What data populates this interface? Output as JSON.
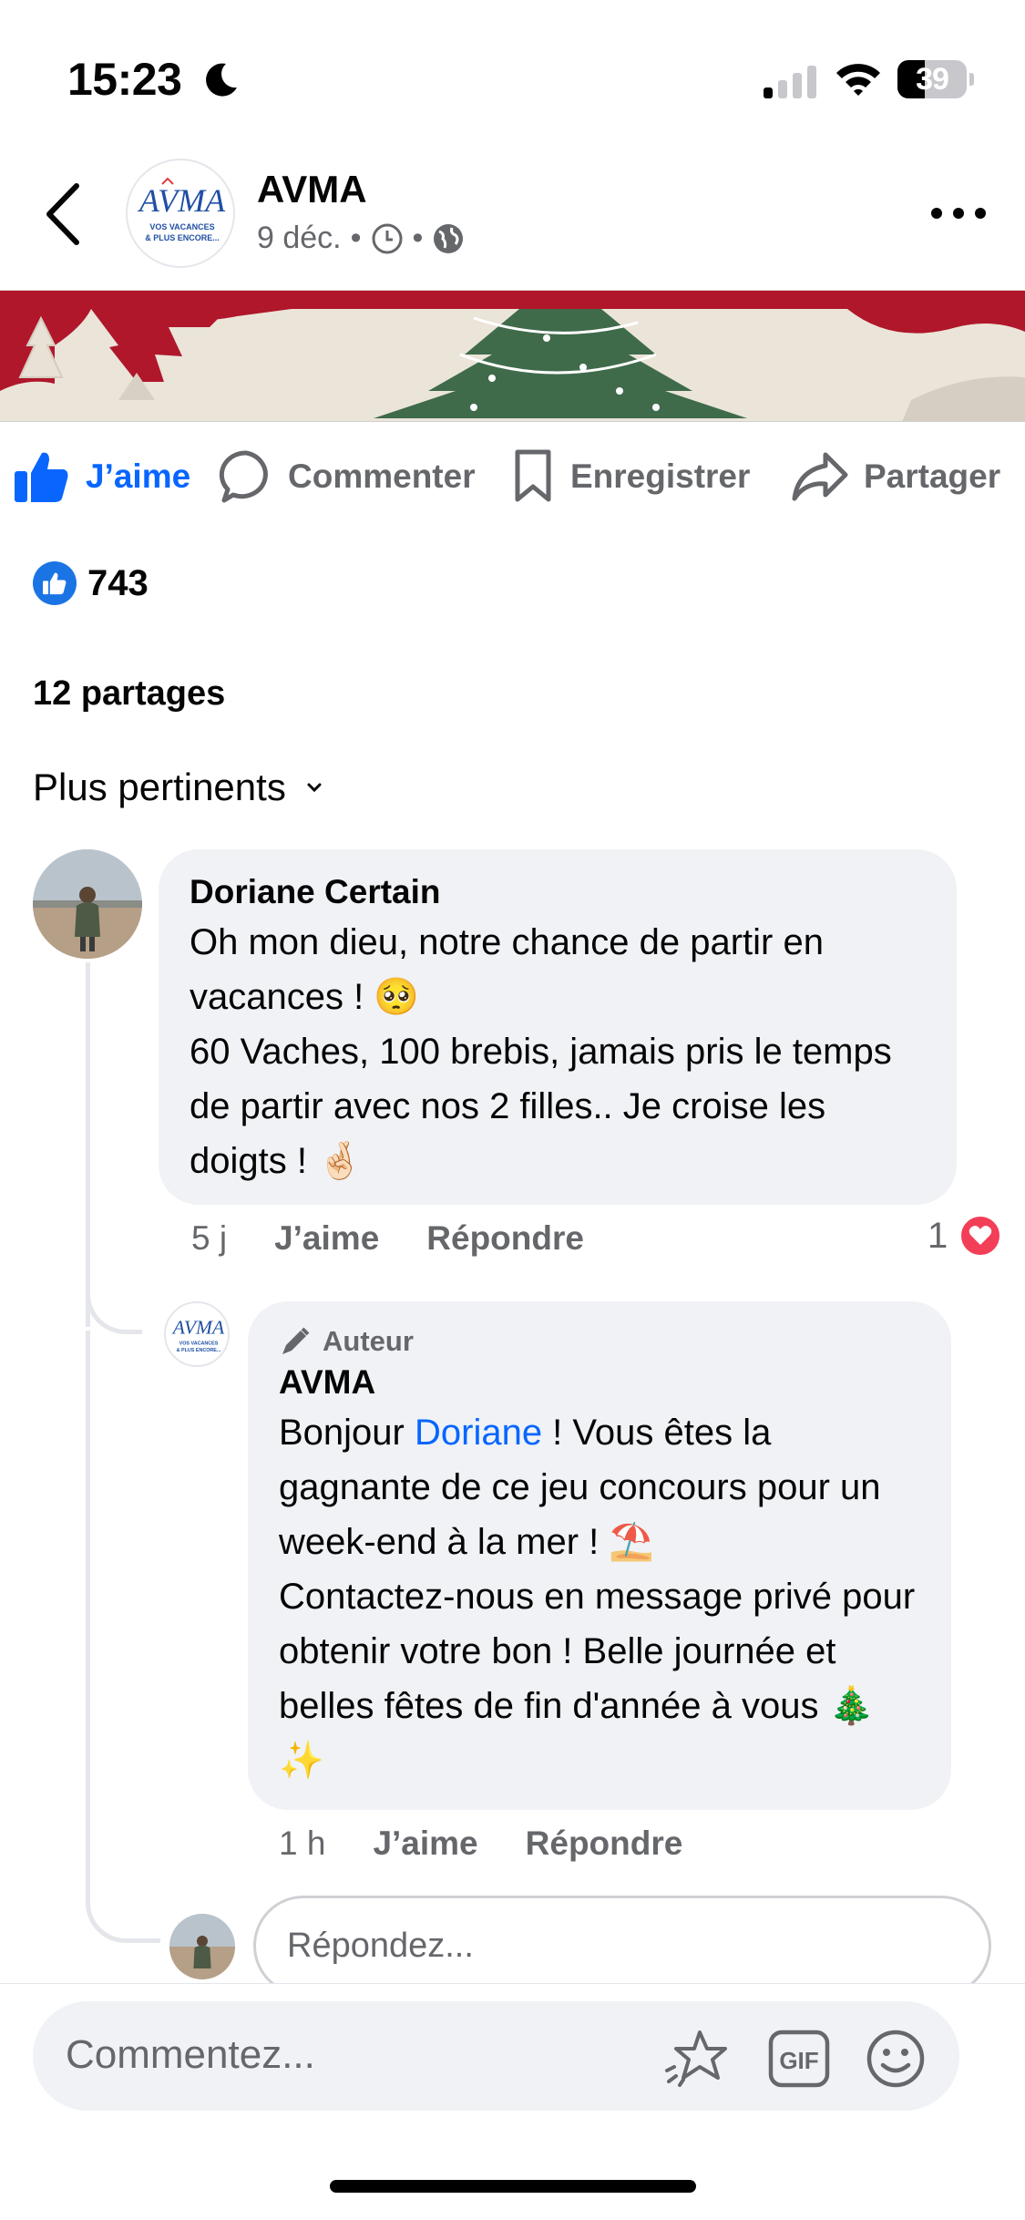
{
  "status_bar": {
    "time": "15:23",
    "battery": "39",
    "battery_level": 0.39
  },
  "header": {
    "page_name": "AVMA",
    "date": "9 déc.",
    "separator": "•",
    "avatar_logo": "AVMA",
    "avatar_tagline_1": "VOS VACANCES",
    "avatar_tagline_2": "& PLUS ENCORE..."
  },
  "actions": {
    "like": "J’aime",
    "comment": "Commenter",
    "save": "Enregistrer",
    "share": "Partager"
  },
  "reactions": {
    "count": "743"
  },
  "shares": "12 partages",
  "sort": {
    "label": "Plus pertinents"
  },
  "comments": [
    {
      "author": "Doriane Certain",
      "text": "Oh mon dieu, notre chance de partir en vacances ! 🥺\n60 Vaches, 100 brebis, jamais pris le temps de partir avec nos 2 filles.. Je croise les doigts ! 🤞🏻",
      "time": "5 j",
      "like": "J’aime",
      "reply": "Répondre",
      "love_count": "1"
    }
  ],
  "reply": {
    "badge": "Auteur",
    "author": "AVMA",
    "text_before": "Bonjour ",
    "mention": "Doriane",
    "text_after": " ! Vous êtes la gagnante de ce jeu concours pour un week-end à la mer ! ⛱️\nContactez-nous en message privé pour obtenir votre bon ! Belle journée et belles fêtes de fin d'année à vous 🎄 ✨",
    "time": "1 h",
    "like": "J’aime",
    "reply": "Répondre"
  },
  "reply_input": {
    "placeholder": "Répondez..."
  },
  "composer": {
    "placeholder": "Commentez...",
    "gif_label": "GIF"
  },
  "colors": {
    "accent": "#0866ff",
    "bubble": "#f0f2f5",
    "muted": "#65676b",
    "love": "#f33e58",
    "banner_red": "#b0172b",
    "tree_green": "#3f6b4b"
  }
}
